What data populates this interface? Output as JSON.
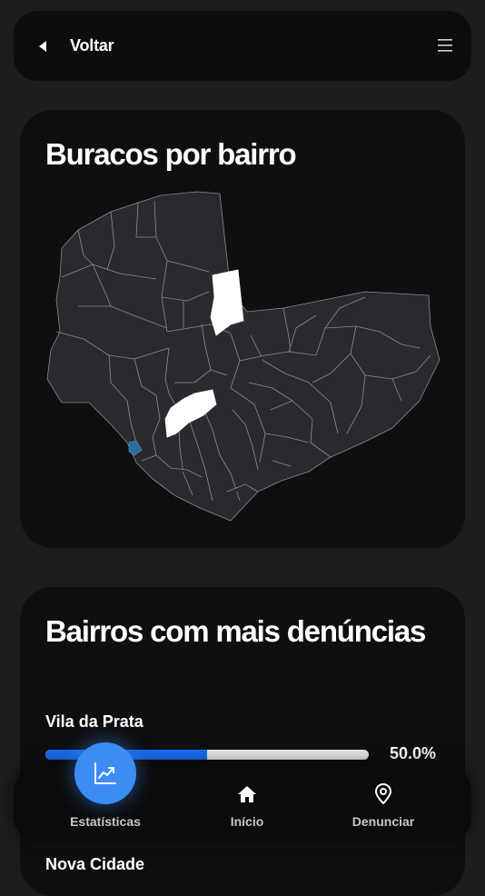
{
  "header": {
    "back_label": "Voltar",
    "back_icon": "caret-left-icon",
    "menu_icon": "hamburger-menu-icon"
  },
  "map_section": {
    "title": "Buracos por bairro",
    "colors": {
      "background": "#0f0f11",
      "region_fill": "#2a2a2e",
      "region_stroke": "#8a8a90",
      "highlight_high": "#ffffff",
      "highlight_low": "#1f6fa8"
    }
  },
  "ranking_section": {
    "title": "Bairros com mais denúncias",
    "items": [
      {
        "name": "Vila da Prata",
        "percent_label": "50.0%",
        "percent": 50.0
      }
    ],
    "next_item_partial": "Nova Cidade"
  },
  "bottom_nav": {
    "items": [
      {
        "label": "Estatísticas",
        "icon": "chart-trend-icon",
        "active": true
      },
      {
        "label": "Início",
        "icon": "home-icon",
        "active": false
      },
      {
        "label": "Denunciar",
        "icon": "map-pin-icon",
        "active": false
      }
    ]
  },
  "colors": {
    "page_bg": "#1c1d1f",
    "card_bg": "#0f0f11",
    "accent": "#1a6ff5",
    "fab": "#3b8df4",
    "bar_track": "#e8e8ea"
  }
}
